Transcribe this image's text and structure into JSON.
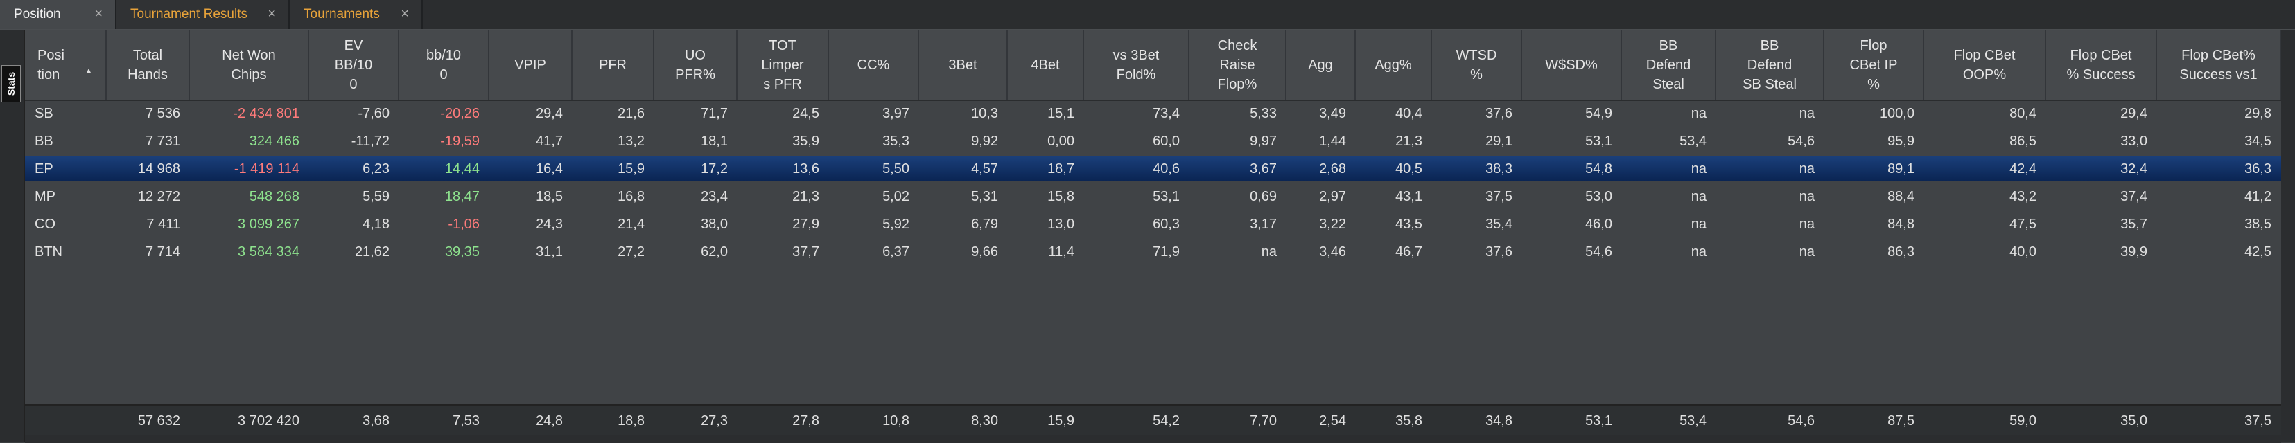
{
  "tabs": [
    {
      "label": "Position",
      "active": true
    },
    {
      "label": "Tournament Results",
      "active": false
    },
    {
      "label": "Tournaments",
      "active": false
    }
  ],
  "side_tab_label": "Stats",
  "columns": [
    "Posi\ntion",
    "Total\nHands",
    "Net Won\nChips",
    "EV\nBB/10\n0",
    "bb/10\n0",
    "VPIP",
    "PFR",
    "UO\nPFR%",
    "TOT\nLimper\ns PFR",
    "CC%",
    "3Bet",
    "4Bet",
    "vs 3Bet\nFold%",
    "Check\nRaise\nFlop%",
    "Agg",
    "Agg%",
    "WTSD\n%",
    "W$SD%",
    "BB\nDefend\nSteal",
    "BB\nDefend\nSB Steal",
    "Flop\nCBet IP\n%",
    "Flop CBet\nOOP%",
    "Flop CBet\n% Success",
    "Flop CBet%\nSuccess vs1"
  ],
  "rows": [
    {
      "cells": [
        "SB",
        "7 536",
        "-2 434 801",
        "-7,60",
        "-20,26",
        "29,4",
        "21,6",
        "71,7",
        "24,5",
        "3,97",
        "10,3",
        "15,1",
        "73,4",
        "5,33",
        "3,49",
        "40,4",
        "37,6",
        "54,9",
        "na",
        "na",
        "100,0",
        "80,4",
        "29,4",
        "29,8"
      ],
      "net_sign": "neg",
      "bb_sign": "neg",
      "selected": false
    },
    {
      "cells": [
        "BB",
        "7 731",
        "324 466",
        "-11,72",
        "-19,59",
        "41,7",
        "13,2",
        "18,1",
        "35,9",
        "35,3",
        "9,92",
        "0,00",
        "60,0",
        "9,97",
        "1,44",
        "21,3",
        "29,1",
        "53,1",
        "53,4",
        "54,6",
        "95,9",
        "86,5",
        "33,0",
        "34,5"
      ],
      "net_sign": "pos",
      "bb_sign": "neg",
      "selected": false
    },
    {
      "cells": [
        "EP",
        "14 968",
        "-1 419 114",
        "6,23",
        "14,44",
        "16,4",
        "15,9",
        "17,2",
        "13,6",
        "5,50",
        "4,57",
        "18,7",
        "40,6",
        "3,67",
        "2,68",
        "40,5",
        "38,3",
        "54,8",
        "na",
        "na",
        "89,1",
        "42,4",
        "32,4",
        "36,3"
      ],
      "net_sign": "neg",
      "bb_sign": "pos",
      "selected": true
    },
    {
      "cells": [
        "MP",
        "12 272",
        "548 268",
        "5,59",
        "18,47",
        "18,5",
        "16,8",
        "23,4",
        "21,3",
        "5,02",
        "5,31",
        "15,8",
        "53,1",
        "0,69",
        "2,97",
        "43,1",
        "37,5",
        "53,0",
        "na",
        "na",
        "88,4",
        "43,2",
        "37,4",
        "41,2"
      ],
      "net_sign": "pos",
      "bb_sign": "pos",
      "selected": false
    },
    {
      "cells": [
        "CO",
        "7 411",
        "3 099 267",
        "4,18",
        "-1,06",
        "24,3",
        "21,4",
        "38,0",
        "27,9",
        "5,92",
        "6,79",
        "13,0",
        "60,3",
        "3,17",
        "3,22",
        "43,5",
        "35,4",
        "46,0",
        "na",
        "na",
        "84,8",
        "47,5",
        "35,7",
        "38,5"
      ],
      "net_sign": "pos",
      "bb_sign": "neg",
      "selected": false
    },
    {
      "cells": [
        "BTN",
        "7 714",
        "3 584 334",
        "21,62",
        "39,35",
        "31,1",
        "27,2",
        "62,0",
        "37,7",
        "6,37",
        "9,66",
        "11,4",
        "71,9",
        "na",
        "3,46",
        "46,7",
        "37,6",
        "54,6",
        "na",
        "na",
        "86,3",
        "40,0",
        "39,9",
        "42,5"
      ],
      "net_sign": "pos",
      "bb_sign": "pos",
      "selected": false
    }
  ],
  "totals": [
    "",
    "57 632",
    "3 702 420",
    "3,68",
    "7,53",
    "24,8",
    "18,8",
    "27,3",
    "27,8",
    "10,8",
    "8,30",
    "15,9",
    "54,2",
    "7,70",
    "2,54",
    "35,8",
    "34,8",
    "53,1",
    "53,4",
    "54,6",
    "87,5",
    "59,0",
    "35,0",
    "37,5"
  ],
  "colors": {
    "negative": "#ff7b7b",
    "positive": "#8ee38e",
    "selected_row": "#0a2452",
    "inactive_tab_text": "#e8a33a"
  }
}
